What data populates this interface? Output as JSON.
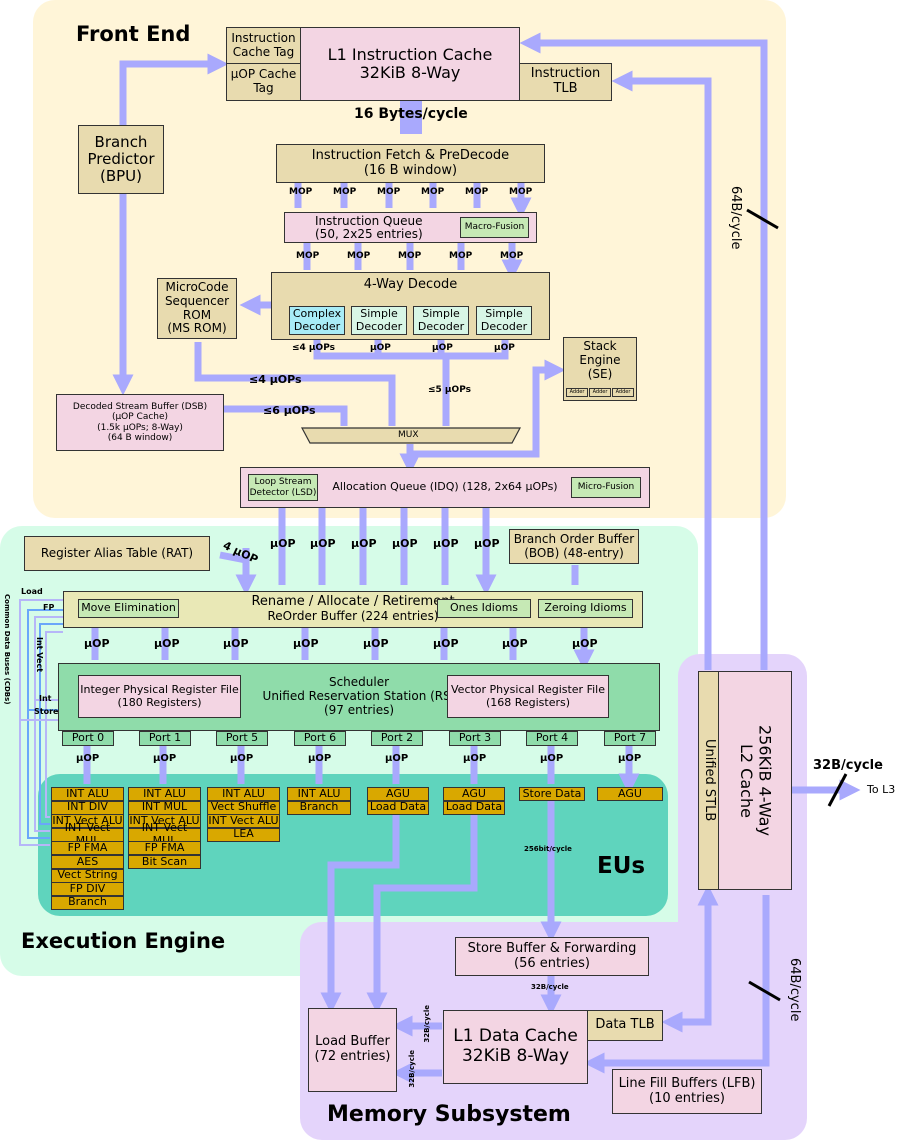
{
  "regions": {
    "front_end": "Front End",
    "execution_engine": "Execution Engine",
    "eus": "EUs",
    "memory_subsystem": "Memory Subsystem"
  },
  "front_end": {
    "icache_tag": "Instruction Cache Tag",
    "uop_cache_tag": "µOP Cache Tag",
    "l1i_line1": "L1 Instruction Cache",
    "l1i_line2": "32KiB 8-Way",
    "itlb_line1": "Instruction",
    "itlb_line2": "TLB",
    "fetch_rate": "16 Bytes/cycle",
    "bpu_line1": "Branch",
    "bpu_line2": "Predictor",
    "bpu_line3": "(BPU)",
    "fetch_line1": "Instruction Fetch & PreDecode",
    "fetch_line2": "(16 B window)",
    "mop_label": "MOP",
    "iq_line1": "Instruction Queue",
    "iq_line2": "(50, 2x25 entries)",
    "macro_fusion": "Macro-Fusion",
    "decode_title": "4-Way Decode",
    "complex_decoder": "Complex Decoder",
    "simple_decoder": "Simple Decoder",
    "msrom_line1": "MicroCode",
    "msrom_line2": "Sequencer",
    "msrom_line3": "ROM",
    "msrom_line4": "(MS ROM)",
    "le4uops": "≤4 µOPs",
    "uop": "µOP",
    "le4uops_msrom": "≤4 µOPs",
    "le5uops": "≤5 µOPs",
    "le6uops": "≤6 µOPs",
    "dsb_line1": "Decoded Stream Buffer (DSB)",
    "dsb_line2": "(µOP Cache)",
    "dsb_line3": "(1.5k µOPs; 8-Way)",
    "dsb_line4": "(64 B window)",
    "se_line1": "Stack",
    "se_line2": "Engine",
    "se_line3": "(SE)",
    "adder": "Adder",
    "mux": "MUX",
    "lsd_line1": "Loop Stream",
    "lsd_line2": "Detector (LSD)",
    "idq": "Allocation Queue (IDQ) (128, 2x64 µOPs)",
    "micro_fusion": "Micro-Fusion",
    "l2_to_l1i_rate": "64B/cycle"
  },
  "execution": {
    "rat": "Register Alias Table (RAT)",
    "four_uop": "4 µOP",
    "uop": "µOP",
    "bob_line1": "Branch Order Buffer",
    "bob_line2": "(BOB) (48-entry)",
    "rob_line1": "Rename / Allocate / Retirement",
    "rob_line2": "ReOrder Buffer (224 entries)",
    "move_elim": "Move Elimination",
    "ones_idioms": "Ones Idioms",
    "zeroing_idioms": "Zeroing Idioms",
    "sched_line1": "Scheduler",
    "sched_line2": "Unified Reservation Station (RS)",
    "sched_line3": "(97 entries)",
    "int_prf_line1": "Integer Physical Register File",
    "int_prf_line2": "(180 Registers)",
    "vec_prf_line1": "Vector Physical Register File",
    "vec_prf_line2": "(168 Registers)",
    "cdb_label": "Common Data Buses (CDBs)",
    "cdb_load": "Load",
    "cdb_fp": "FP",
    "cdb_intvect": "Int Vect",
    "cdb_int": "Int",
    "cdb_store": "Store",
    "store_rate": "256bit/cycle",
    "ports": [
      {
        "name": "Port 0",
        "units": [
          "INT ALU",
          "INT DIV",
          "INT Vect ALU",
          "INT Vect MUL",
          "FP FMA",
          "AES",
          "Vect String",
          "FP DIV",
          "Branch"
        ]
      },
      {
        "name": "Port 1",
        "units": [
          "INT ALU",
          "INT MUL",
          "INT Vect ALU",
          "INT Vect MUL",
          "FP FMA",
          "Bit Scan"
        ]
      },
      {
        "name": "Port 5",
        "units": [
          "INT ALU",
          "Vect Shuffle",
          "INT Vect ALU",
          "LEA"
        ]
      },
      {
        "name": "Port 6",
        "units": [
          "INT ALU",
          "Branch"
        ]
      },
      {
        "name": "Port 2",
        "units": [
          "AGU",
          "Load Data"
        ]
      },
      {
        "name": "Port 3",
        "units": [
          "AGU",
          "Load Data"
        ]
      },
      {
        "name": "Port 4",
        "units": [
          "Store Data"
        ]
      },
      {
        "name": "Port 7",
        "units": [
          "AGU"
        ]
      }
    ]
  },
  "memory": {
    "stlb": "Unified STLB",
    "l2_line1": "L2 Cache",
    "l2_line2": "256KiB 4-Way",
    "l3_rate": "32B/cycle",
    "to_l3": "To L3",
    "sb_line1": "Store Buffer & Forwarding",
    "sb_line2": "(56 entries)",
    "sb_rate": "32B/cycle",
    "lb_line1": "Load Buffer",
    "lb_line2": "(72 entries)",
    "l1d_line1": "L1 Data Cache",
    "l1d_line2": "32KiB 8-Way",
    "dtlb": "Data TLB",
    "lfb_line1": "Line Fill Buffers (LFB)",
    "lfb_line2": "(10 entries)",
    "load_rate_a": "32B/cycle",
    "load_rate_b": "32B/cycle",
    "l2_l1d_rate": "64B/cycle"
  }
}
